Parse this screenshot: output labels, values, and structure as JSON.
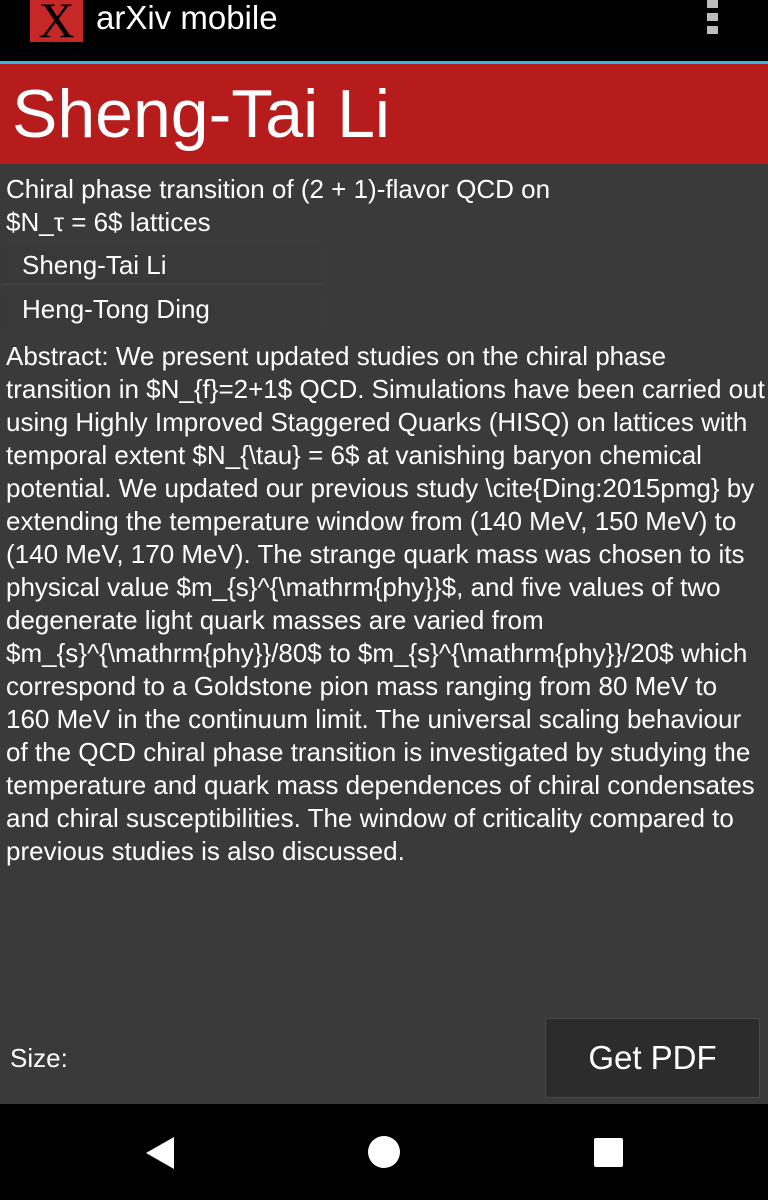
{
  "app": {
    "logo_letter": "X",
    "title": "arXiv mobile"
  },
  "header": {
    "name": "Sheng-Tai Li"
  },
  "paper": {
    "title": "Chiral phase transition of (2 + 1)-flavor QCD on $N_τ = 6$ lattices",
    "authors": [
      "Sheng-Tai Li",
      "Heng-Tong Ding"
    ],
    "abstract": "Abstract:   We present updated studies on the chiral phase transition in $N_{f}=2+1$ QCD. Simulations have been carried out using Highly Improved Staggered Quarks (HISQ) on lattices with temporal extent $N_{\\tau} = 6$ at vanishing baryon chemical potential. We updated our previous study \\cite{Ding:2015pmg} by extending the temperature window from (140 MeV, 150 MeV) to (140 MeV, 170 MeV). The strange quark mass was chosen to its physical value $m_{s}^{\\mathrm{phy}}$, and five values of two degenerate light quark masses are varied from $m_{s}^{\\mathrm{phy}}/80$ to $m_{s}^{\\mathrm{phy}}/20$ which correspond to a Goldstone pion mass ranging from 80 MeV to 160 MeV in the continuum limit. The universal scaling behaviour of the QCD chiral phase transition is investigated by studying the temperature and quark mass dependences of chiral condensates and chiral susceptibilities. The window of criticality compared to previous studies is also discussed."
  },
  "footer": {
    "size_label": "Size:",
    "pdf_button": "Get PDF"
  },
  "colors": {
    "header_red": "#b71c1c",
    "background": "#3a3a3a",
    "accent_line": "#33b5e5"
  },
  "icons": [
    "app-logo-icon",
    "overflow-menu-icon",
    "nav-back-icon",
    "nav-home-icon",
    "nav-recent-icon"
  ]
}
